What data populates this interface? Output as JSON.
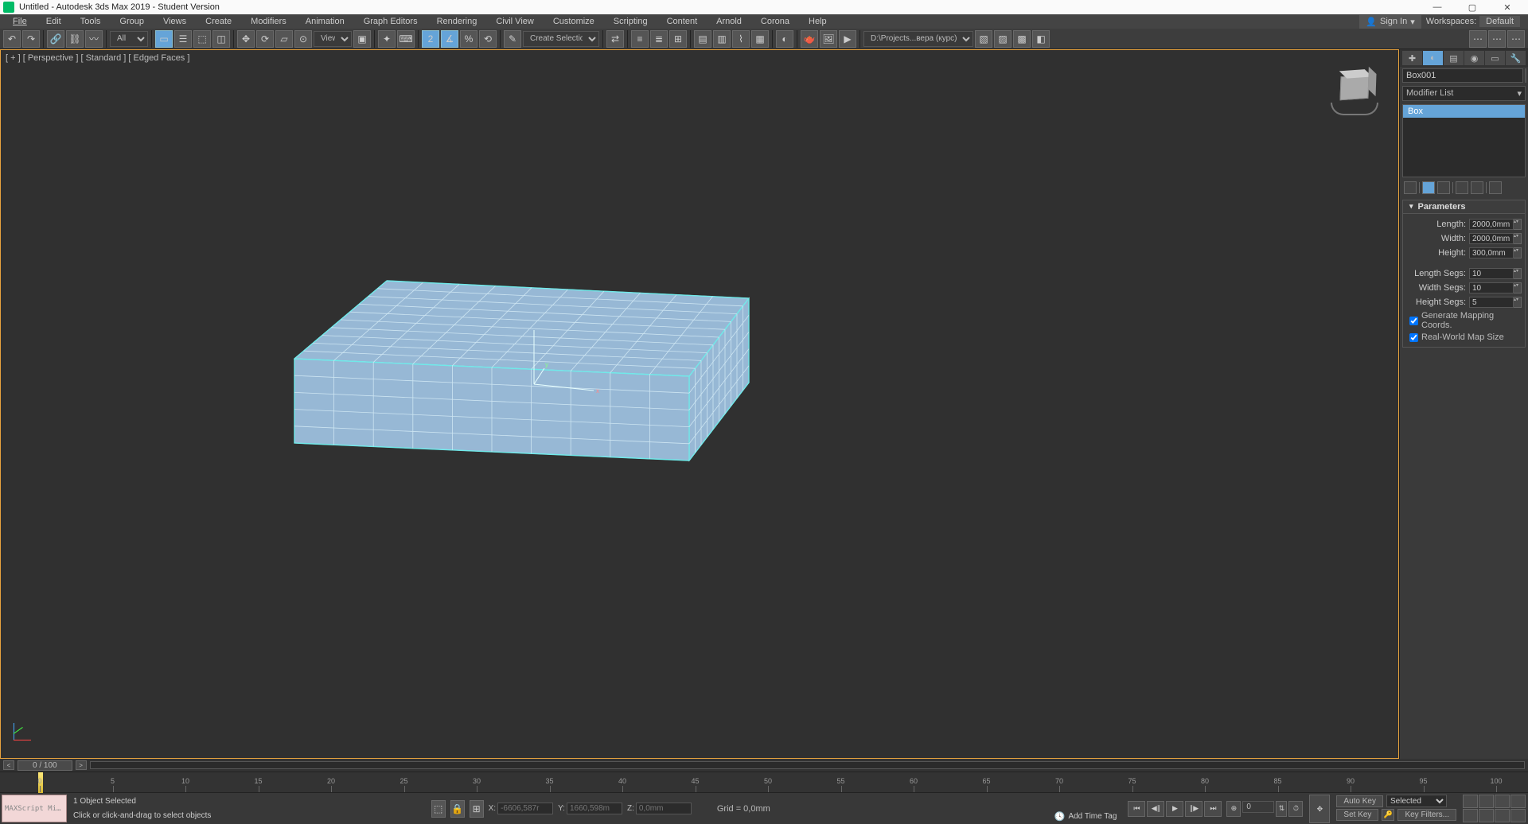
{
  "titlebar": {
    "title": "Untitled - Autodesk 3ds Max 2019 - Student Version"
  },
  "menus": [
    "File",
    "Edit",
    "Tools",
    "Group",
    "Views",
    "Create",
    "Modifiers",
    "Animation",
    "Graph Editors",
    "Rendering",
    "Civil View",
    "Customize",
    "Scripting",
    "Content",
    "Arnold",
    "Corona",
    "Help"
  ],
  "signin": "Sign In",
  "workspaces_label": "Workspaces:",
  "workspaces_value": "Default",
  "toolbar": {
    "selfilter": "All",
    "viewlabel": "View",
    "selset": "Create Selection Se",
    "project": "D:\\Projects...вера (курс)"
  },
  "viewport": {
    "label": "[ + ] [ Perspective ] [ Standard ] [ Edged Faces ]"
  },
  "cmdpanel": {
    "objname": "Box001",
    "modlist": "Modifier List",
    "stack_item": "Box",
    "rollup_title": "Parameters",
    "length_lbl": "Length:",
    "length_val": "2000,0mm",
    "width_lbl": "Width:",
    "width_val": "2000,0mm",
    "height_lbl": "Height:",
    "height_val": "300,0mm",
    "lsegs_lbl": "Length Segs:",
    "lsegs_val": "10",
    "wsegs_lbl": "Width Segs:",
    "wsegs_val": "10",
    "hsegs_lbl": "Height Segs:",
    "hsegs_val": "5",
    "genmap": "Generate Mapping Coords.",
    "realworld": "Real-World Map Size"
  },
  "timeslider": {
    "frame": "0 / 100"
  },
  "trackbar_ticks": [
    0,
    5,
    10,
    15,
    20,
    25,
    30,
    35,
    40,
    45,
    50,
    55,
    60,
    65,
    70,
    75,
    80,
    85,
    90,
    95,
    100
  ],
  "status": {
    "mxs": "MAXScript Mi…",
    "selinfo": "1 Object Selected",
    "prompt": "Click or click-and-drag to select objects",
    "x_lbl": "X:",
    "x_val": "-6606,587r",
    "y_lbl": "Y:",
    "y_val": "1660,598m",
    "z_lbl": "Z:",
    "z_val": "0,0mm",
    "grid": "Grid = 0,0mm",
    "addtime": "Add Time Tag",
    "autokey": "Auto Key",
    "setkey": "Set Key",
    "selected": "Selected",
    "keyfilters": "Key Filters...",
    "framefield": "0"
  }
}
